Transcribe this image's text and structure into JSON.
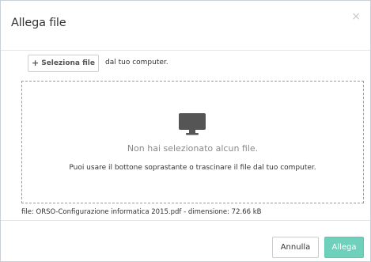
{
  "modal": {
    "title": "Allega file",
    "close_glyph": "×"
  },
  "upload": {
    "select_button_icon": "+",
    "select_button_label": "Seleziona file",
    "from_computer_text": "dal tuo computer.",
    "dropzone_icon": "monitor-icon",
    "empty_message": "Non hai selezionato alcun file.",
    "hint_message": "Puoi usare il bottone soprastante o trascinare il file dal tuo computer.",
    "file_info": "file: ORSO-Configurazione informatica 2015.pdf - dimensione: 72.66 kB"
  },
  "footer": {
    "cancel_label": "Annulla",
    "attach_label": "Allega"
  },
  "colors": {
    "accent": "#6fd0bb",
    "border": "#c9d0d6",
    "muted_text": "#8a8a8a",
    "icon": "#555555"
  }
}
